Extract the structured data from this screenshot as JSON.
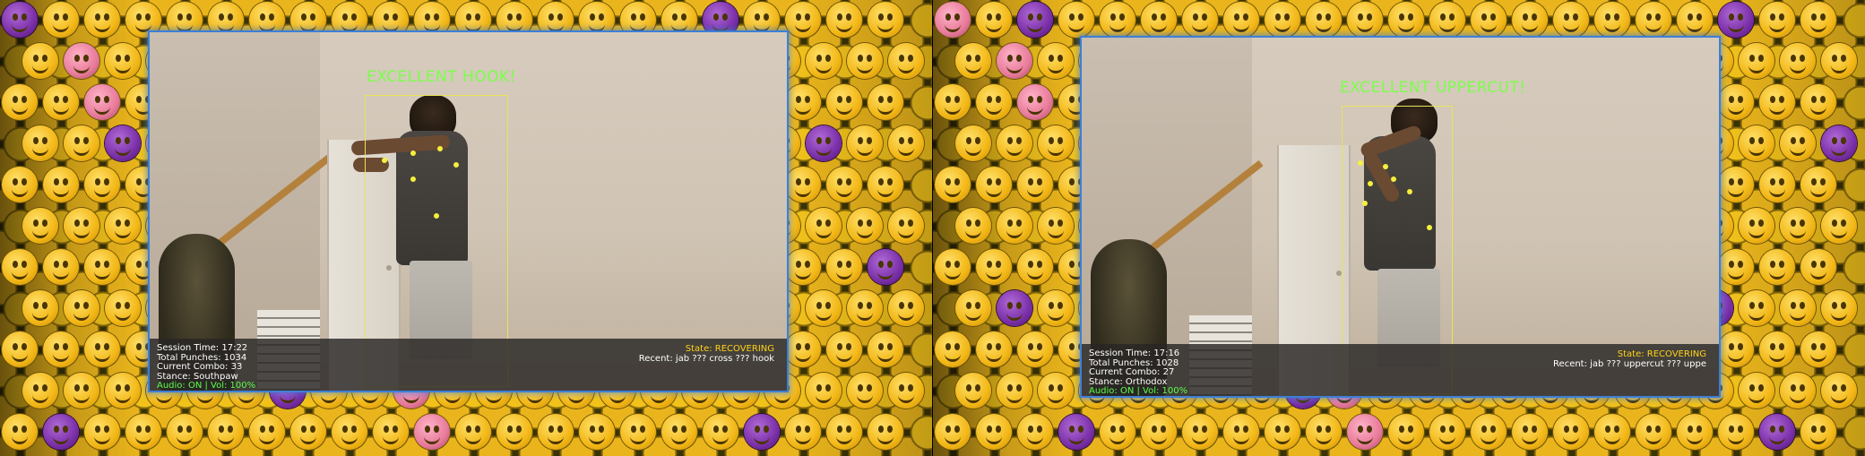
{
  "frames": [
    {
      "feedback": "EXCELLENT HOOK!",
      "stats": {
        "session_time": "Session Time: 17:22",
        "total_punches": "Total Punches: 1034",
        "current_combo": "Current Combo: 33",
        "stance": "Stance: Southpaw",
        "audio": "Audio: ON | Vol: 100%"
      },
      "state": "State: RECOVERING",
      "recent": "Recent: jab ??? cross ??? hook"
    },
    {
      "feedback": "EXCELLENT UPPERCUT!",
      "stats": {
        "session_time": "Session Time: 17:16",
        "total_punches": "Total Punches: 1028",
        "current_combo": "Current Combo: 27",
        "stance": "Stance: Orthodox",
        "audio": "Audio: ON | Vol: 100%"
      },
      "state": "State: RECOVERING",
      "recent": "Recent: jab ??? uppercut ??? uppe"
    }
  ],
  "colors": {
    "feedback_text": "#7bff4a",
    "state_text": "#ffd21a",
    "audio_text": "#5cff4a",
    "bbox": "#e8e35a",
    "keypoint": "#f5f03c",
    "window_border": "#3d7fd6"
  },
  "icons": [
    "emoji-background",
    "keypoint-dot"
  ]
}
